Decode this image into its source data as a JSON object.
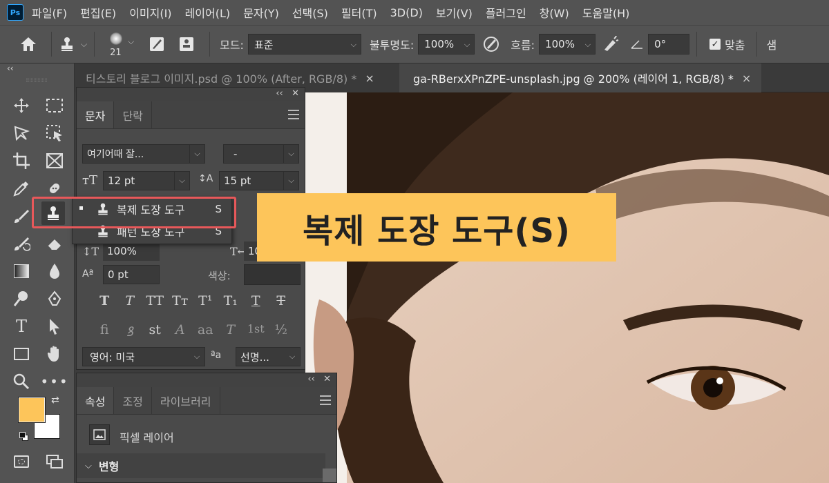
{
  "app": {
    "logo": "Ps"
  },
  "menu": [
    "파일(F)",
    "편집(E)",
    "이미지(I)",
    "레이어(L)",
    "문자(Y)",
    "선택(S)",
    "필터(T)",
    "3D(D)",
    "보기(V)",
    "플러그인",
    "창(W)",
    "도움말(H)"
  ],
  "options": {
    "brush_size": "21",
    "mode_label": "모드:",
    "mode_value": "표준",
    "opacity_label": "불투명도:",
    "opacity_value": "100%",
    "flow_label": "흐름:",
    "flow_value": "100%",
    "angle_value": "0°",
    "aligned_label": "맞춤",
    "cut_label": "샘"
  },
  "tabs": [
    {
      "label": "티스토리 블로그 이미지.psd @ 100% (After, RGB/8) *",
      "close": "×"
    },
    {
      "label": "ga-RBerxXPnZPE-unsplash.jpg @ 200% (레이어 1, RGB/8) *",
      "close": "×"
    }
  ],
  "character_panel": {
    "tabs": [
      "문자",
      "단락"
    ],
    "font_family": "여기어때 잘...",
    "font_style": "-",
    "font_size": "12 pt",
    "leading": "15 pt",
    "vertical_scale": "100%",
    "horizontal_scale_partial": "10",
    "baseline_shift": "0 pt",
    "color_label": "색상:",
    "style_glyphs": [
      "T",
      "T",
      "TT",
      "Tт",
      "T¹",
      "T₁",
      "T",
      "T"
    ],
    "opentype_glyphs": [
      "fi",
      "ꝸ",
      "st",
      "A",
      "aa",
      "T",
      "1st",
      "½"
    ],
    "language": "영어: 미국",
    "antialias_label": "ªa",
    "antialias_value": "선명..."
  },
  "flyout": {
    "items": [
      {
        "label": "복제 도장 도구",
        "shortcut": "S",
        "selected": true
      },
      {
        "label": "패턴 도장 도구",
        "shortcut": "S",
        "selected": false
      }
    ]
  },
  "properties_panel": {
    "tabs": [
      "속성",
      "조정",
      "라이브러리"
    ],
    "layer_type": "픽셀 레이어",
    "section": "변형"
  },
  "callout": {
    "text": "복제 도장 도구(S)"
  },
  "colors": {
    "foreground": "#fdc55a",
    "background": "#ffffff",
    "callout_bg": "#fdc55a",
    "highlight_border": "#e8585a",
    "ui_dark": "#535353"
  }
}
